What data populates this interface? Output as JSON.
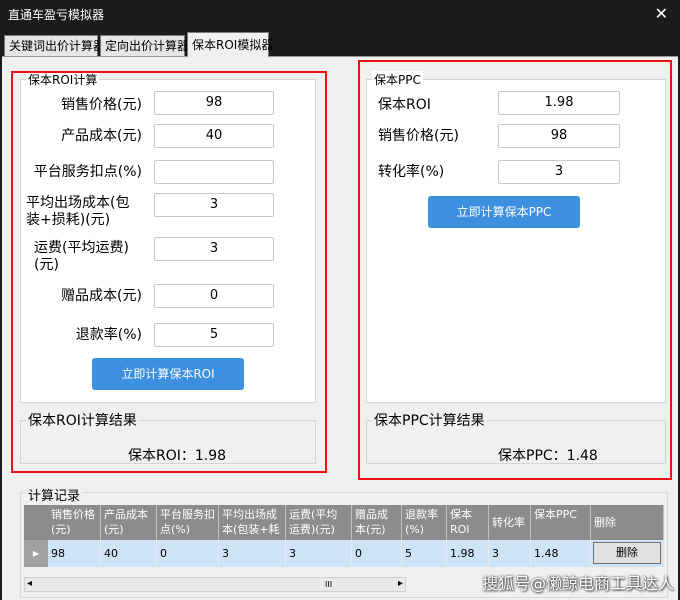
{
  "window": {
    "title": "直通车盈亏模拟器",
    "close_symbol": "✕"
  },
  "tabs": [
    {
      "label": "关键词出价计算器"
    },
    {
      "label": "定向出价计算器"
    },
    {
      "label": "保本ROI模拟器"
    }
  ],
  "roi_calc": {
    "legend": "保本ROI计算",
    "fields": [
      {
        "label": "销售价格(元)",
        "value": "98"
      },
      {
        "label": "产品成本(元)",
        "value": "40"
      },
      {
        "label": "平台服务扣点(%)",
        "value": ""
      },
      {
        "label": "平均出场成本(包装+损耗)(元)",
        "label_line1": "平均出场成本(包",
        "label_line2": "装+损耗)(元)",
        "value": "3"
      },
      {
        "label": "运费(平均运费)(元)",
        "label_line1": "运费(平均运费)",
        "label_line2": "(元)",
        "value": "3"
      },
      {
        "label": "赠品成本(元)",
        "value": "0"
      },
      {
        "label": "退款率(%)",
        "value": "5"
      }
    ],
    "button": "立即计算保本ROI",
    "result_title": "保本ROI计算结果",
    "result_text": "保本ROI：1.98"
  },
  "ppc_calc": {
    "legend": "保本PPC",
    "fields": [
      {
        "label": "保本ROI",
        "value": "1.98"
      },
      {
        "label": "销售价格(元)",
        "value": "98"
      },
      {
        "label": "转化率(%)",
        "value": "3"
      }
    ],
    "button": "立即计算保本PPC",
    "result_title": "保本PPC计算结果",
    "result_text": "保本PPC：1.48"
  },
  "records": {
    "legend": "计算记录",
    "columns": [
      "销售价格(元)",
      "产品成本(元)",
      "平台服务扣点(%)",
      "平均出场成本(包装+耗",
      "运费(平均运费)(元)",
      "赠品成本(元)",
      "退款率(%)",
      "保本ROI",
      "转化率",
      "保本PPC",
      "删除"
    ],
    "rows": [
      {
        "cells": [
          "98",
          "40",
          "0",
          "3",
          "3",
          "0",
          "5",
          "1.98",
          "3",
          "1.48"
        ],
        "action": "删除"
      }
    ]
  },
  "scrollbar": {
    "left_arrow": "◂",
    "right_arrow": "▸",
    "thumb": "III"
  },
  "watermark": "搜狐号@懒鲸电商工具达人",
  "colors": {
    "accent_button": "#3d8fe0",
    "highlight_border": "#ee1111",
    "grid_header": "#8c8c8c",
    "grid_row": "#cde3f7"
  }
}
